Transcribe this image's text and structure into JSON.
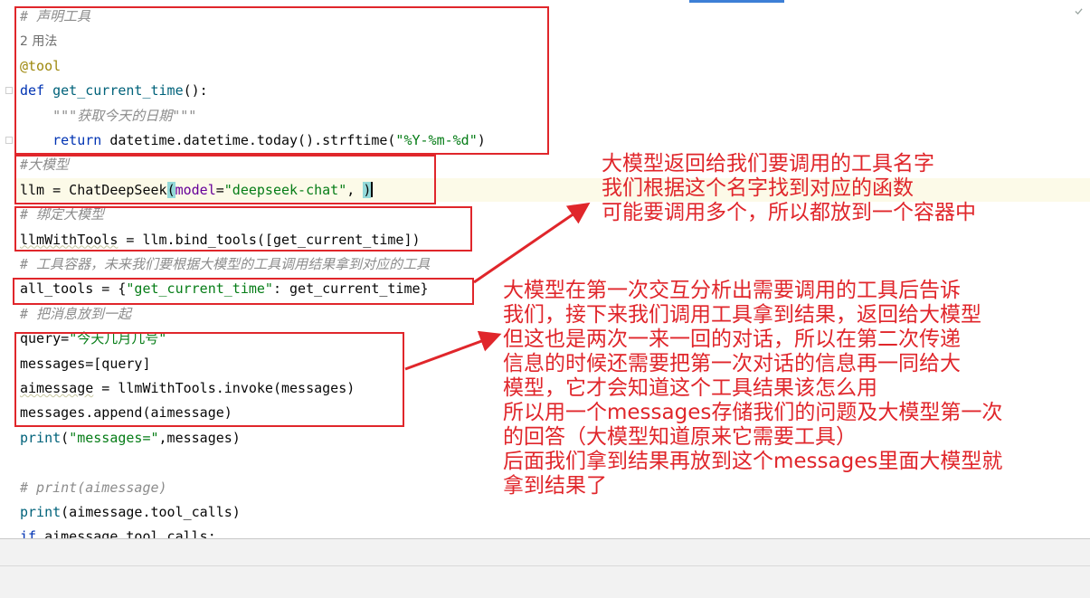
{
  "code_lines": [
    {
      "segments": [
        {
          "cls": "c",
          "text": "# 声明工具"
        }
      ]
    },
    {
      "segments": [
        {
          "cls": "plain-cn",
          "text": "2 用法"
        }
      ]
    },
    {
      "segments": [
        {
          "cls": "dec",
          "text": "@tool"
        }
      ]
    },
    {
      "segments": [
        {
          "cls": "kw",
          "text": "def "
        },
        {
          "cls": "fn",
          "text": "get_current_time"
        },
        {
          "cls": "",
          "text": "():"
        }
      ]
    },
    {
      "segments": [
        {
          "cls": "c",
          "text": "    \"\"\"获取今天的日期\"\"\""
        }
      ]
    },
    {
      "segments": [
        {
          "cls": "kw",
          "text": "    return "
        },
        {
          "cls": "",
          "text": "datetime.datetime.today().strftime("
        },
        {
          "cls": "str",
          "text": "\"%Y-%m-%d\""
        },
        {
          "cls": "",
          "text": ")"
        }
      ]
    },
    {
      "segments": [
        {
          "cls": "c",
          "text": "#大模型"
        }
      ]
    },
    {
      "segments": [
        {
          "cls": "",
          "text": "llm = ChatDeepSeek"
        },
        {
          "cls": "paren-hl",
          "text": "("
        },
        {
          "cls": "param",
          "text": "model"
        },
        {
          "cls": "",
          "text": "="
        },
        {
          "cls": "str",
          "text": "\"deepseek-chat\""
        },
        {
          "cls": "",
          "text": ", "
        },
        {
          "cls": "paren-hl",
          "text": ")"
        },
        {
          "cls": "caret",
          "text": ""
        }
      ]
    },
    {
      "segments": [
        {
          "cls": "c",
          "text": "# 绑定大模型"
        }
      ]
    },
    {
      "segments": [
        {
          "cls": "squiggle",
          "text": "llmWithTools"
        },
        {
          "cls": "",
          "text": " = llm.bind_tools([get_current_time])"
        }
      ]
    },
    {
      "segments": [
        {
          "cls": "c",
          "text": "# 工具容器，未来我们要根据大模型的工具调用结果拿到对应的工具"
        }
      ]
    },
    {
      "segments": [
        {
          "cls": "",
          "text": "all_tools = {"
        },
        {
          "cls": "str",
          "text": "\"get_current_time\""
        },
        {
          "cls": "",
          "text": ": get_current_time}"
        }
      ]
    },
    {
      "segments": [
        {
          "cls": "c",
          "text": "# 把消息放到一起"
        }
      ]
    },
    {
      "segments": [
        {
          "cls": "",
          "text": "query="
        },
        {
          "cls": "str",
          "text": "\"今天几月几号\""
        }
      ]
    },
    {
      "segments": [
        {
          "cls": "",
          "text": "messages=[query]"
        }
      ]
    },
    {
      "segments": [
        {
          "cls": "squiggle",
          "text": "aimessage"
        },
        {
          "cls": "",
          "text": " = llmWithTools.invoke(messages)"
        }
      ]
    },
    {
      "segments": [
        {
          "cls": "",
          "text": "messages.append(aimessage)"
        }
      ]
    },
    {
      "segments": [
        {
          "cls": "fn",
          "text": "print"
        },
        {
          "cls": "",
          "text": "("
        },
        {
          "cls": "str",
          "text": "\"messages=\""
        },
        {
          "cls": "",
          "text": ",messages)"
        }
      ]
    },
    {
      "segments": [
        {
          "cls": "",
          "text": ""
        }
      ]
    },
    {
      "segments": [
        {
          "cls": "c",
          "text": "# print(aimessage)"
        }
      ]
    },
    {
      "segments": [
        {
          "cls": "fn",
          "text": "print"
        },
        {
          "cls": "",
          "text": "(aimessage.tool_calls)"
        }
      ]
    },
    {
      "segments": [
        {
          "cls": "kw",
          "text": "if "
        },
        {
          "cls": "",
          "text": "aimessage.tool_calls:"
        }
      ]
    }
  ],
  "annotations": {
    "note1": [
      "大模型返回给我们要调用的工具名字",
      "我们根据这个名字找到对应的函数",
      "可能要调用多个，所以都放到一个容器中"
    ],
    "note2": [
      "大模型在第一次交互分析出需要调用的工具后告诉",
      "我们，接下来我们调用工具拿到结果，返回给大模型",
      "但这也是两次一来一回的对话，所以在第二次传递",
      "信息的时候还需要把第一次对话的信息再一同给大",
      "模型，它才会知道这个工具结果该怎么用",
      "所以用一个messages存储我们的问题及大模型第一次",
      "的回答（大模型知道原来它需要工具）",
      "后面我们拿到结果再放到这个messages里面大模型就",
      "拿到结果了"
    ]
  },
  "colors": {
    "annotation": "#e0262b",
    "comment": "#8c8c8c",
    "keyword": "#0033b3",
    "string": "#067d17"
  },
  "icons": {
    "scroll_marker": "check-icon"
  }
}
